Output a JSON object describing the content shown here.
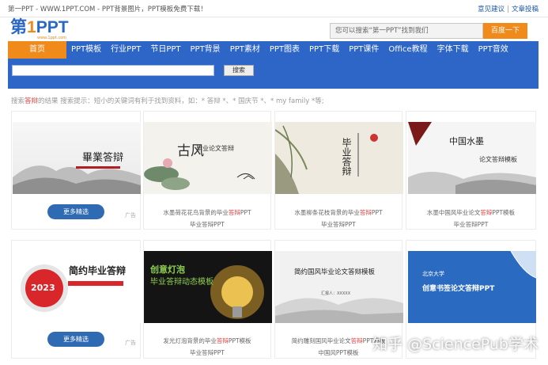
{
  "topbar": {
    "left_text": "第一PPT - WWW.1PPT.COM - PPT背景图片，PPT模板免费下载！",
    "feedback": "意见建议",
    "separator": "|",
    "contribute": "文章投稿"
  },
  "logo": {
    "main_prefix": "第",
    "main_one": "1",
    "main_suffix": "PPT",
    "sub": "www.1ppt.com"
  },
  "top_search": {
    "placeholder": "您可以搜索“第一PPT”找到我们",
    "button": "百度一下"
  },
  "nav": {
    "items": [
      "首页",
      "PPT模板",
      "行业PPT",
      "节日PPT",
      "PPT背景",
      "PPT素材",
      "PPT图表",
      "PPT下载",
      "PPT课件",
      "Office教程",
      "字体下载",
      "PPT音效"
    ]
  },
  "site_search": {
    "button": "搜索"
  },
  "hint": {
    "before": "搜索",
    "keyword": "答辩",
    "after": "的结果 搜索提示：短小的关键词有利于找到资料，如：* 答辩 *、* 国庆节 *、* my family *等;"
  },
  "cards": [
    {
      "thumb_title": "畢業答辯",
      "thumb_sub": "XXX答辩 XXXXXXXX",
      "more": "更多精选",
      "ad": "广告"
    },
    {
      "thumb_title": "古风",
      "thumb_sub": "毕业论文答辩",
      "cap_pre": "水墨荷花花鸟背景的毕业",
      "cap_kw": "答辩",
      "cap_post": "PPT",
      "sub": "毕业答辩PPT"
    },
    {
      "thumb_title": "毕业答辩",
      "cap_pre": "水墨柳条花枝背景的毕业",
      "cap_kw": "答辩",
      "cap_post": "PPT",
      "sub": "毕业答辩PPT"
    },
    {
      "thumb_title": "中国水墨",
      "thumb_sub": "论文答辩模板",
      "cap_pre": "水墨中国风毕业论文",
      "cap_kw": "答辩",
      "cap_post": "PPT模板",
      "sub": "毕业答辩PPT"
    },
    {
      "thumb_title": "简约毕业答辩",
      "thumb_badge": "2023",
      "more": "更多精选",
      "ad": "广告"
    },
    {
      "thumb_title": "创意灯泡",
      "thumb_sub": "毕业答辩动态模板",
      "cap_pre": "发光灯泡背景的毕业",
      "cap_kw": "答辩",
      "cap_post": "PPT模板",
      "sub": "毕业答辩PPT"
    },
    {
      "thumb_title": "简约国风毕业论文答辩模板",
      "thumb_sub": "汇报人：XXXXX",
      "cap_pre": "简约雕刻国风毕业论文",
      "cap_kw": "答辩",
      "cap_post": "PPT模板",
      "sub": "中国风PPT模板"
    },
    {
      "thumb_title": "创意书签论文答辩PPT",
      "thumb_sub": "北京大学",
      "cap_pre": "",
      "cap_kw": "",
      "cap_post": "",
      "sub": ""
    }
  ],
  "watermark": "知乎 @SciencePub学术",
  "colors": {
    "nav_blue": "#2e66c8",
    "accent_orange": "#f08a1a",
    "keyword_red": "#e23b3b",
    "button_blue": "#2f6bb3"
  }
}
